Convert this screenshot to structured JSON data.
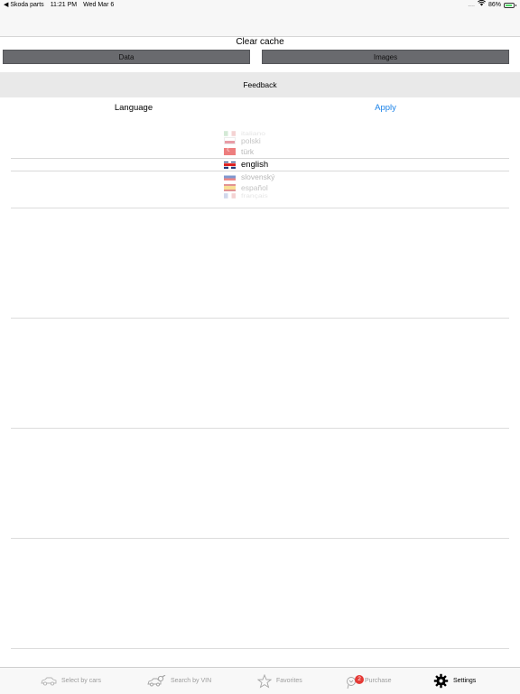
{
  "status_bar": {
    "back_label": "◀ Skoda parts",
    "time": "11:21 PM",
    "date": "Wed Mar 6",
    "signal": "....",
    "battery_percent": "86%",
    "battery_level": 0.86
  },
  "cache": {
    "title": "Clear cache",
    "data_button": "Data",
    "images_button": "Images"
  },
  "feedback_label": "Feedback",
  "language": {
    "label": "Language",
    "apply": "Apply",
    "options": [
      {
        "name": "italiano",
        "flag": "italy-flag-icon"
      },
      {
        "name": "polski",
        "flag": "poland-flag-icon"
      },
      {
        "name": "türk",
        "flag": "turkey-flag-icon"
      },
      {
        "name": "english",
        "flag": "uk-flag-icon",
        "selected": true
      },
      {
        "name": "slovenský",
        "flag": "slovakia-flag-icon"
      },
      {
        "name": "español",
        "flag": "spain-flag-icon"
      },
      {
        "name": "français",
        "flag": "france-flag-icon"
      }
    ]
  },
  "tab_bar": {
    "tabs": [
      {
        "label": "Select by cars",
        "icon": "car-icon"
      },
      {
        "label": "Search by VIN",
        "icon": "vin-scan-icon"
      },
      {
        "label": "Favorites",
        "icon": "star-icon"
      },
      {
        "label": "Purchase",
        "icon": "purchase-icon",
        "badge": "2"
      },
      {
        "label": "Settings",
        "icon": "gear-icon",
        "active": true
      }
    ]
  }
}
